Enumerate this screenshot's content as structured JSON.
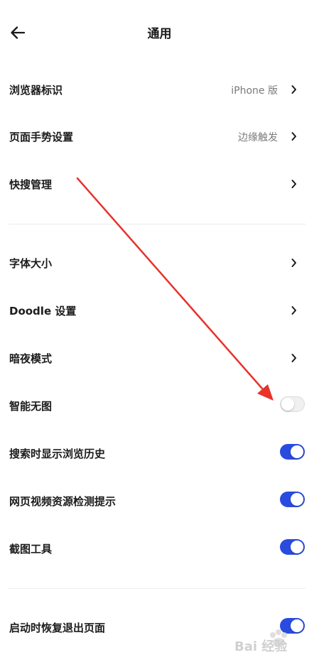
{
  "header": {
    "title": "通用",
    "back_icon": "arrow-left-icon"
  },
  "section1": [
    {
      "label": "浏览器标识",
      "value": "iPhone 版"
    },
    {
      "label": "页面手势设置",
      "value": "边缘触发"
    },
    {
      "label": "快搜管理",
      "value": ""
    }
  ],
  "section2": [
    {
      "label": "字体大小"
    },
    {
      "label": "Doodle 设置"
    },
    {
      "label": "暗夜模式"
    },
    {
      "label": "智能无图",
      "toggle": false
    },
    {
      "label": "搜索时显示浏览历史",
      "toggle": true
    },
    {
      "label": "网页视频资源检测提示",
      "toggle": true
    },
    {
      "label": "截图工具",
      "toggle": true
    }
  ],
  "section3": [
    {
      "label": "启动时恢复退出页面",
      "toggle": true
    }
  ],
  "annotation": {
    "arrow_color": "#e8322b"
  },
  "watermark": {
    "text": "Bai 经验"
  },
  "colors": {
    "toggle_on": "#2a4bdf",
    "toggle_off": "#f0f0f0"
  }
}
